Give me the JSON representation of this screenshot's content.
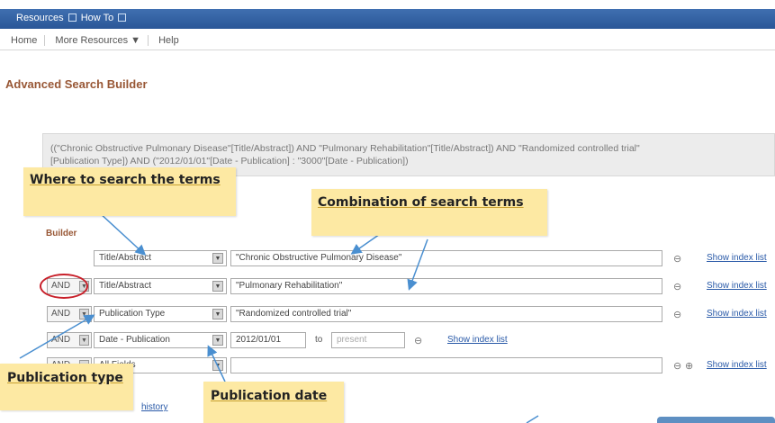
{
  "topbar": {
    "resources": "Resources",
    "howto": "How To"
  },
  "subnav": {
    "home": "Home",
    "more": "More Resources ▼",
    "help": "Help"
  },
  "page_title": "Advanced Search Builder",
  "query": {
    "line1": "((\"Chronic Obstructive Pulmonary Disease\"[Title/Abstract]) AND \"Pulmonary Rehabilitation\"[Title/Abstract]) AND \"Randomized controlled trial\"",
    "line2": "[Publication Type]) AND (\"2012/01/01\"[Date - Publication] : \"3000\"[Date - Publication])"
  },
  "builder_label": "Builder",
  "rows": [
    {
      "bool": "",
      "field": "Title/Abstract",
      "term": "\"Chronic Obstructive Pulmonary Disease\"",
      "index": "Show index list"
    },
    {
      "bool": "AND",
      "field": "Title/Abstract",
      "term": "\"Pulmonary Rehabilitation\"",
      "index": "Show index list"
    },
    {
      "bool": "AND",
      "field": "Publication Type",
      "term": "\"Randomized controlled trial\"",
      "index": "Show index list"
    },
    {
      "bool": "AND",
      "field": "Date - Publication",
      "from": "2012/01/01",
      "to_label": "to",
      "to": "present",
      "index": "Show index list"
    },
    {
      "bool": "AND",
      "field": "All Fields",
      "term": "",
      "index": "Show index list"
    }
  ],
  "history_link": "history",
  "notes": {
    "where": "Where to search the terms",
    "combination": "Combination of search terms",
    "pubtype": "Publication type",
    "pubdate": "Publication date"
  },
  "colors": {
    "accent": "#985735",
    "link": "#2a5aa8",
    "note": "#fde9a3",
    "circle": "#c8202a",
    "arrow": "#4a8fd0"
  }
}
